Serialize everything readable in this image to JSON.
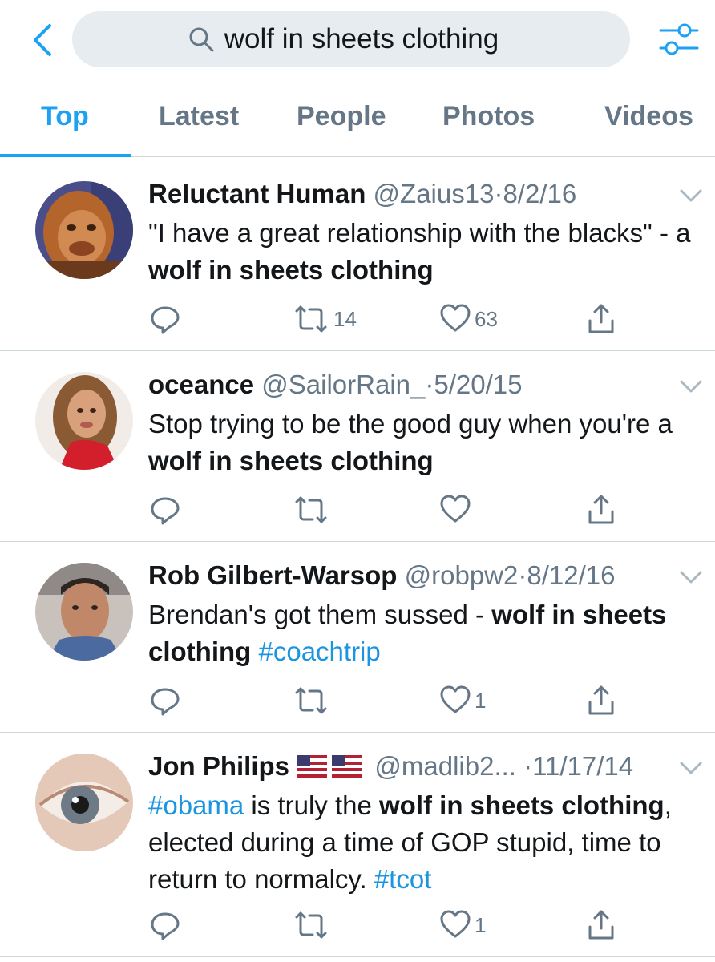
{
  "search": {
    "query": "wolf in sheets clothing"
  },
  "tabs": [
    {
      "label": "Top",
      "active": true
    },
    {
      "label": "Latest",
      "active": false
    },
    {
      "label": "People",
      "active": false
    },
    {
      "label": "Photos",
      "active": false
    },
    {
      "label": "Videos",
      "active": false
    }
  ],
  "colors": {
    "accent": "#1da1f2",
    "link": "#1b95e0",
    "muted": "#657786",
    "search_bg": "#e6ecf0",
    "divider": "#ccd6dd"
  },
  "tweets": [
    {
      "name": "Reluctant Human",
      "handle": "@Zaius13",
      "sep": "·",
      "date": "8/2/16",
      "text_plain_1": "\"I have a great relationship with the blacks\" - a ",
      "text_bold_1": "wolf in sheets clothing",
      "reply_count": "",
      "retweet_count": "14",
      "like_count": "63"
    },
    {
      "name": "oceance",
      "handle": "@SailorRain_",
      "sep": "·",
      "date": "5/20/15",
      "text_plain_1": "Stop trying to be the good guy when you're a ",
      "text_bold_1": "wolf in sheets clothing",
      "reply_count": "",
      "retweet_count": "",
      "like_count": ""
    },
    {
      "name": "Rob Gilbert-Warsop",
      "handle": "@robpw2",
      "sep": "·",
      "date": "8/12/16",
      "text_plain_1": "Brendan's got them sussed - ",
      "text_bold_1": "wolf in sheets clothing",
      "text_space": " ",
      "hashtag_1": "#coachtrip",
      "reply_count": "",
      "retweet_count": "",
      "like_count": "1"
    },
    {
      "name": "Jon Philips",
      "flags": [
        "us-flag-icon",
        "us-flag-icon"
      ],
      "handle": "@madlib2...",
      "sep": "·",
      "date": "11/17/14",
      "hashtag_1": "#obama",
      "text_plain_1": " is truly the ",
      "text_bold_1": "wolf in sheets clothing",
      "text_plain_2": ", elected during a time of GOP stupid, time to return to normalcy. ",
      "hashtag_2": "#tcot",
      "reply_count": "",
      "retweet_count": "",
      "like_count": "1"
    }
  ]
}
